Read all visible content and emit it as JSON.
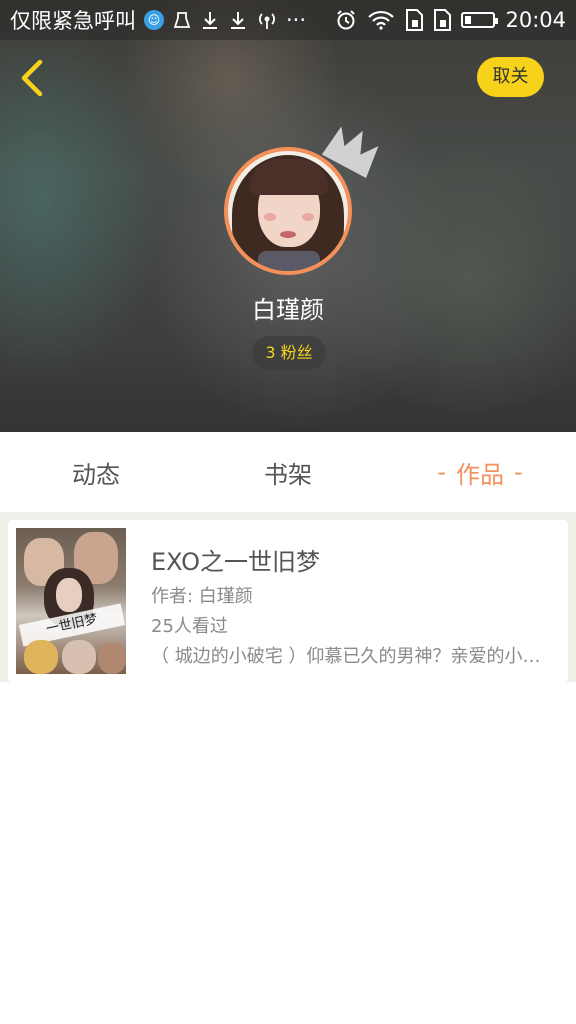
{
  "status_bar": {
    "carrier_text": "仅限紧急呼叫",
    "time": "20:04",
    "icons": [
      "app-notification-icon",
      "cleaner-icon",
      "download-icon",
      "download-icon",
      "hotspot-icon",
      "more-dots-icon",
      "alarm-icon",
      "wifi-icon",
      "sim-card-icon",
      "sim-card-icon",
      "battery-icon"
    ],
    "more_text": "···"
  },
  "header": {
    "back_icon": "chevron-left-icon",
    "unfollow_label": "取关",
    "user_name": "白瑾颜",
    "fans_label": "3 粉丝",
    "accent_color": "#f4915a",
    "badge_color": "#f7d21b"
  },
  "tabs": [
    {
      "label": "动态",
      "active": false
    },
    {
      "label": "书架",
      "active": false
    },
    {
      "label": "作品",
      "active": true
    }
  ],
  "tab_active_dash": "-",
  "works": [
    {
      "title": "EXO之一世旧梦",
      "author": "作者: 白瑾颜",
      "views": "25人看过",
      "description": "（ 城边的小破宅 ）仰慕已久的男神？亲爱的小…",
      "cover_text": "一世旧梦"
    }
  ]
}
